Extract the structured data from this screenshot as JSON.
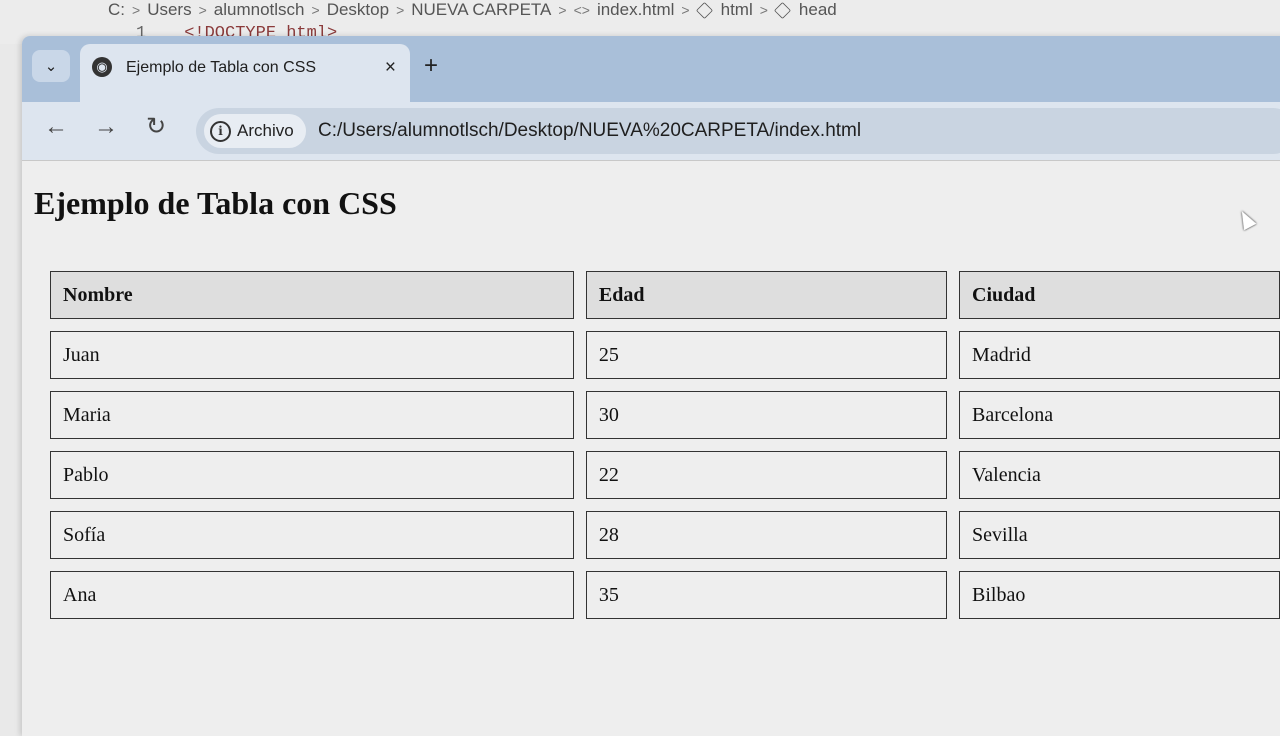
{
  "editor": {
    "breadcrumbs": [
      "C:",
      "Users",
      "alumnotlsch",
      "Desktop",
      "NUEVA CARPETA",
      "index.html",
      "html",
      "head"
    ],
    "code_line_number": "1",
    "code_line_text": "<!DOCTYPE html>"
  },
  "browser": {
    "tab_title": "Ejemplo de Tabla con CSS",
    "tab_close": "×",
    "new_tab": "+",
    "site_chip_label": "Archivo",
    "url": "C:/Users/alumnotlsch/Desktop/NUEVA%20CARPETA/index.html"
  },
  "page": {
    "heading": "Ejemplo de Tabla con CSS",
    "table": {
      "headers": [
        "Nombre",
        "Edad",
        "Ciudad"
      ],
      "rows": [
        [
          "Juan",
          "25",
          "Madrid"
        ],
        [
          "Maria",
          "30",
          "Barcelona"
        ],
        [
          "Pablo",
          "22",
          "Valencia"
        ],
        [
          "Sofía",
          "28",
          "Sevilla"
        ],
        [
          "Ana",
          "35",
          "Bilbao"
        ]
      ]
    }
  },
  "icons": {
    "tab_menu": "chevron-down-icon",
    "favicon": "globe-icon",
    "back": "arrow-left-icon",
    "forward": "arrow-right-icon",
    "reload": "reload-icon",
    "site_info": "info-icon"
  }
}
